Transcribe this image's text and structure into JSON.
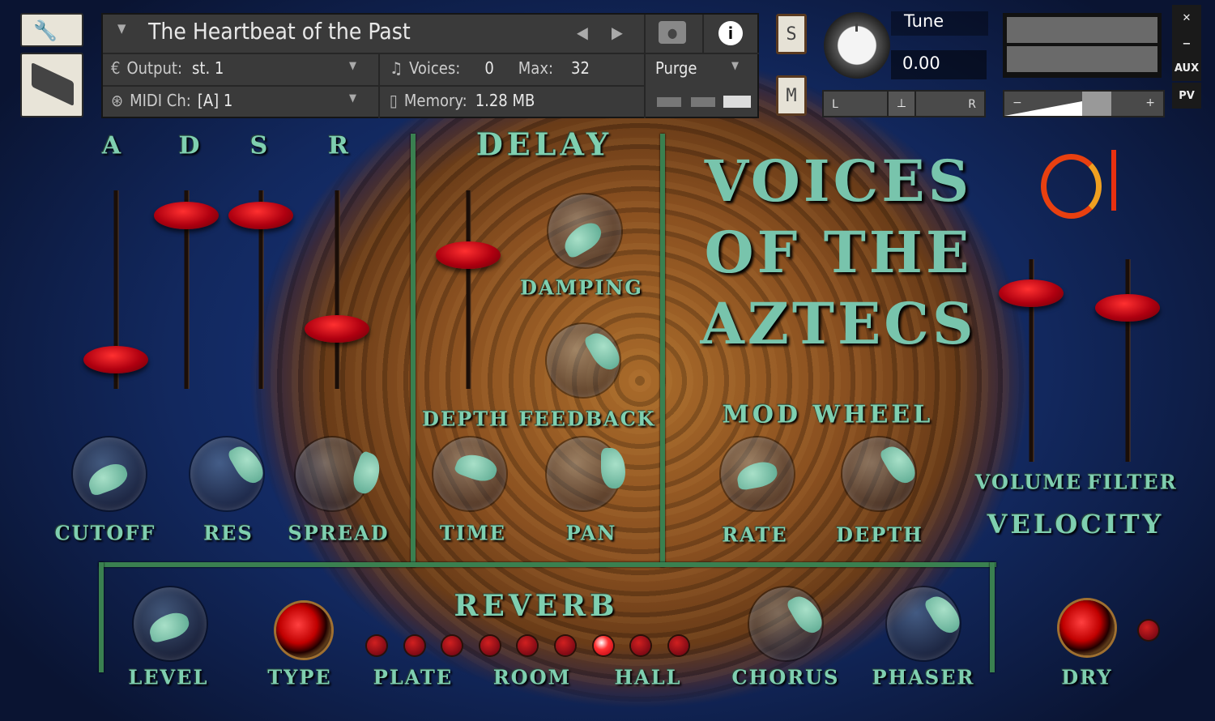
{
  "header": {
    "instrument_name": "The Heartbeat of the Past",
    "output_label": "Output:",
    "output_value": "st. 1",
    "midi_label": "MIDI Ch:",
    "midi_value": "[A]  1",
    "voices_label": "Voices:",
    "voices_value": "0",
    "max_label": "Max:",
    "max_value": "32",
    "memory_label": "Memory:",
    "memory_value": "1.28 MB",
    "purge_label": "Purge",
    "icons": [
      "wrench-icon",
      "keyboard-icon",
      "camera-icon",
      "info-icon"
    ]
  },
  "tune": {
    "label": "Tune",
    "value": "0.00",
    "pan_left": "L",
    "pan_right": "R",
    "vol_minus": "−",
    "vol_plus": "+"
  },
  "solo_label": "S",
  "mute_label": "M",
  "right_buttons": {
    "close": "✕",
    "minimize": "−",
    "aux": "AUX",
    "pv": "PV"
  },
  "adsr": {
    "labels": [
      "A",
      "D",
      "S",
      "R"
    ],
    "values": [
      0.12,
      0.95,
      0.95,
      0.3
    ]
  },
  "filter": {
    "knobs": [
      "CUTOFF",
      "RES",
      "SPREAD"
    ]
  },
  "delay": {
    "title": "DELAY",
    "depth_label": "DEPTH",
    "depth_value": 0.72,
    "damping": "DAMPING",
    "feedback": "FEEDBACK",
    "time": "TIME",
    "pan": "PAN"
  },
  "title_art": [
    "VOICES",
    "OF THE",
    "AZTECS"
  ],
  "mod_wheel": {
    "title": "MOD WHEEL",
    "rate": "RATE",
    "depth": "DEPTH"
  },
  "velocity": {
    "title": "VELOCITY",
    "volume": "VOLUME",
    "filter": "FILTER",
    "volume_value": 0.9,
    "filter_value": 0.82
  },
  "reverb": {
    "title": "REVERB",
    "level": "LEVEL",
    "type": "TYPE",
    "plate": "PLATE",
    "room": "ROOM",
    "hall": "HALL",
    "selected_type_index": 6,
    "chorus": "CHORUS",
    "phaser": "PHASER",
    "dry": "DRY"
  },
  "colors": {
    "label_green": "#7fcfb0",
    "slider_red": "#c00010",
    "frame_green": "#3a8050"
  }
}
